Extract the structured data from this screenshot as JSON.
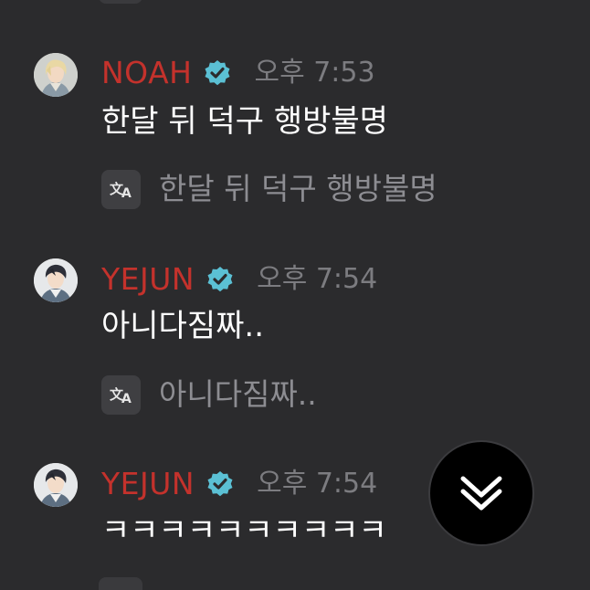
{
  "messages": [
    {
      "author": "NOAH",
      "verified": true,
      "time": "오후 7:53",
      "text": "한달 뒤 덕구 행방불명",
      "translation": "한달 뒤 덕구 행방불명",
      "avatar": "avatar-noah"
    },
    {
      "author": "YEJUN",
      "verified": true,
      "time": "오후 7:54",
      "text": "아니다짐짜..",
      "translation": "아니다짐짜..",
      "avatar": "avatar-yejun"
    },
    {
      "author": "YEJUN",
      "verified": true,
      "time": "오후 7:54",
      "text": "ㅋㅋㅋㅋㅋㅋㅋㅋㅋㅋ",
      "avatar": "avatar-yejun"
    }
  ],
  "icons": {
    "verified": "verified-badge-icon",
    "translate": "translate-icon",
    "scroll": "double-chevron-down-icon"
  },
  "colors": {
    "background": "#2b2b2d",
    "author": "#c4322c",
    "verified": "#5bc0d4",
    "timestamp": "#7c7c80",
    "message_text": "#ffffff",
    "translation_text": "#8d8d92"
  }
}
